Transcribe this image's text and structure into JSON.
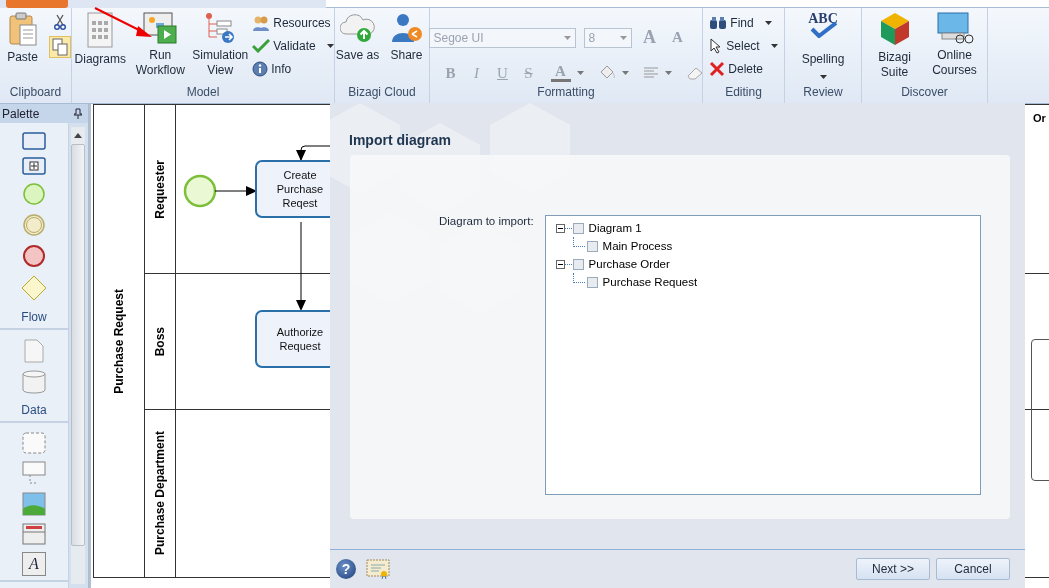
{
  "ribbon": {
    "groups": [
      {
        "label": "Clipboard",
        "items": [
          {
            "kind": "large",
            "label": "Paste"
          },
          {
            "kind": "tools"
          }
        ]
      },
      {
        "label": "Model",
        "items": [
          {
            "kind": "large",
            "label": "Diagrams"
          },
          {
            "kind": "large",
            "label": "Run Workflow"
          },
          {
            "kind": "large",
            "label": "Simulation View"
          },
          {
            "kind": "stack",
            "items": [
              {
                "label": "Resources",
                "dropdown": false
              },
              {
                "label": "Validate",
                "dropdown": true
              },
              {
                "label": "Info",
                "dropdown": false
              }
            ]
          }
        ]
      },
      {
        "label": "Bizagi Cloud",
        "items": [
          {
            "kind": "large",
            "label": "Save as"
          },
          {
            "kind": "large",
            "label": "Share"
          }
        ]
      },
      {
        "label": "Formatting",
        "items": [
          {
            "kind": "formatting",
            "font": "Segoe UI",
            "size": "8",
            "disabled": true,
            "size_buttons": [
              "A",
              "A"
            ],
            "styles": [
              "B",
              "I",
              "U",
              "S"
            ],
            "color_letter": "A"
          }
        ]
      },
      {
        "label": "Editing",
        "items": [
          {
            "kind": "stack",
            "items": [
              {
                "label": "Find",
                "dropdown": true
              },
              {
                "label": "Select",
                "dropdown": true
              },
              {
                "label": "Delete",
                "dropdown": false
              }
            ]
          }
        ]
      },
      {
        "label": "Review",
        "items": [
          {
            "kind": "spelling",
            "label": "Spelling",
            "icon_text": "ABC",
            "dropdown": true
          }
        ]
      },
      {
        "label": "Discover",
        "items": [
          {
            "kind": "large",
            "label": "Bizagi Suite"
          },
          {
            "kind": "large",
            "label": "Online Courses"
          }
        ]
      }
    ]
  },
  "palette": {
    "title": "Palette",
    "sections": [
      {
        "label": "Flow",
        "items": [
          {
            "kind": "task"
          },
          {
            "kind": "subprocess"
          },
          {
            "kind": "start"
          },
          {
            "kind": "intermediate"
          },
          {
            "kind": "end"
          },
          {
            "kind": "gateway"
          }
        ]
      },
      {
        "label": "Data",
        "items": [
          {
            "kind": "document"
          },
          {
            "kind": "store"
          }
        ]
      },
      {
        "items": [
          {
            "kind": "group"
          },
          {
            "kind": "annotation"
          },
          {
            "kind": "image"
          },
          {
            "kind": "header"
          },
          {
            "kind": "text",
            "glyph": "A"
          }
        ]
      }
    ]
  },
  "diagram": {
    "pool": "Purchase Request",
    "lanes": [
      "Requester",
      "Boss",
      "Purchase Department"
    ],
    "tasks": [
      {
        "label": "Create Purchase Reqest"
      },
      {
        "label": "Authorize Request"
      }
    ],
    "offscreen_label": "Or"
  },
  "dialog": {
    "title": "Import diagram",
    "field_label": "Diagram to import:",
    "tree": [
      {
        "label": "Diagram 1",
        "expanded": true,
        "checked": false,
        "children": [
          {
            "label": "Main Process",
            "checked": false
          }
        ]
      },
      {
        "label": "Purchase Order",
        "expanded": true,
        "checked": false,
        "children": [
          {
            "label": "Purchase Request",
            "checked": false
          }
        ]
      }
    ],
    "help": "?",
    "buttons": [
      "Next >>",
      "Cancel"
    ]
  }
}
